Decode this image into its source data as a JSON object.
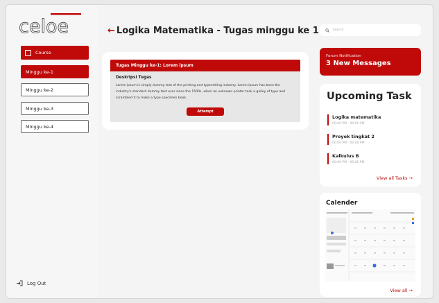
{
  "logo": "celoe",
  "sidebar": {
    "course_label": "Course",
    "weeks": [
      "Minggu ke-1",
      "Minggu ke-2",
      "Minggu ke-3",
      "Minggu ke-4"
    ],
    "logout_label": "Log Out"
  },
  "main": {
    "title": "Logika Matematika - Tugas minggu ke 1",
    "task": {
      "header": "Tugas Minggu ke-1: Lorem ipsum",
      "desc_heading": "Deskripsi Tugas",
      "desc_text": "Lorem ipsum is simply dummy text of the printing and typesetting industry. Lorem Ipsum has been the industry's standard dummy text ever since the 1500s, when an unknown printer took a galley of type and scrambled it to make a type specimen book.",
      "attempt_label": "Attempt"
    }
  },
  "right": {
    "search_placeholder": "Search",
    "notification": {
      "subtitle": "Forum Notification",
      "headline": "3 New Messages"
    },
    "upcoming": {
      "title": "Upcoming Task",
      "tasks": [
        {
          "name": "Logika matematika",
          "time": "00:00 PM - 00:00 PM"
        },
        {
          "name": "Proyek tingkat 2",
          "time": "00:00 PM - 00:00 PM"
        },
        {
          "name": "Kalkulus B",
          "time": "00:00 PM - 00:00 PM"
        }
      ],
      "view_all": "View all Tasks →"
    },
    "calendar": {
      "title": "Calender",
      "view_all": "View all →"
    }
  },
  "colors": {
    "accent": "#c00a0a",
    "background": "#f4f4f4"
  }
}
